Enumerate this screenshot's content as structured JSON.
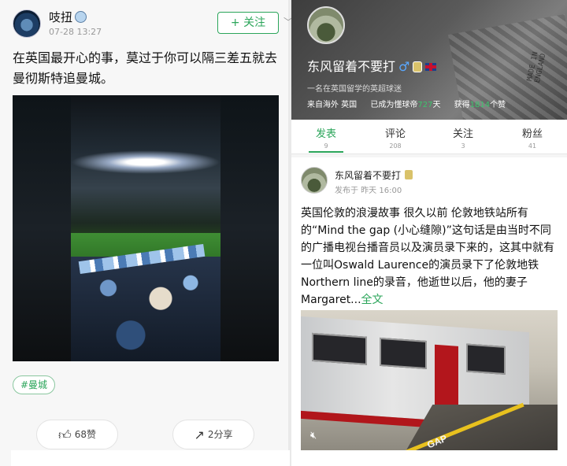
{
  "left_post": {
    "username": "吱扭",
    "time": "07-28 13:27",
    "follow_label": "+ 关注",
    "text": "在英国最开心的事，莫过于你可以隔三差五就去曼彻斯特追曼城。",
    "tag": "#曼城",
    "like_label": "68赞",
    "share_label": "2分享"
  },
  "profile": {
    "name": "东风留着不要打",
    "gender_symbol": "♂",
    "bio": "一名在英国留学的英超球迷",
    "from_label": "来自海外 英国",
    "days_prefix": "已成为懂球帝",
    "days_value": "727",
    "days_suffix": "天",
    "likes_prefix": "获得",
    "likes_value": "1814",
    "likes_suffix": "个赞",
    "hero_text": "MADE IN ENGLAND"
  },
  "tabs": [
    {
      "label": "发表",
      "count": "9",
      "active": true
    },
    {
      "label": "评论",
      "count": "208",
      "active": false
    },
    {
      "label": "关注",
      "count": "3",
      "active": false
    },
    {
      "label": "粉丝",
      "count": "41",
      "active": false
    }
  ],
  "feed_post": {
    "name": "东风留着不要打",
    "time": "发布于 昨天 16:00",
    "text": "英国伦敦的浪漫故事 很久以前 伦敦地铁站所有的“Mind the gap (小心缝隙)”这句话是由当时不同的广播电视台播音员以及演员录下来的，这其中就有一位叫Oswald Laurence的演员录下了伦敦地铁Northern line的录音，他逝世以后，他的妻子Margaret...",
    "more_label": "全文",
    "photo_text": "GAP"
  },
  "colors": {
    "accent": "#2ba55a",
    "stat_green": "#3ec46d"
  }
}
